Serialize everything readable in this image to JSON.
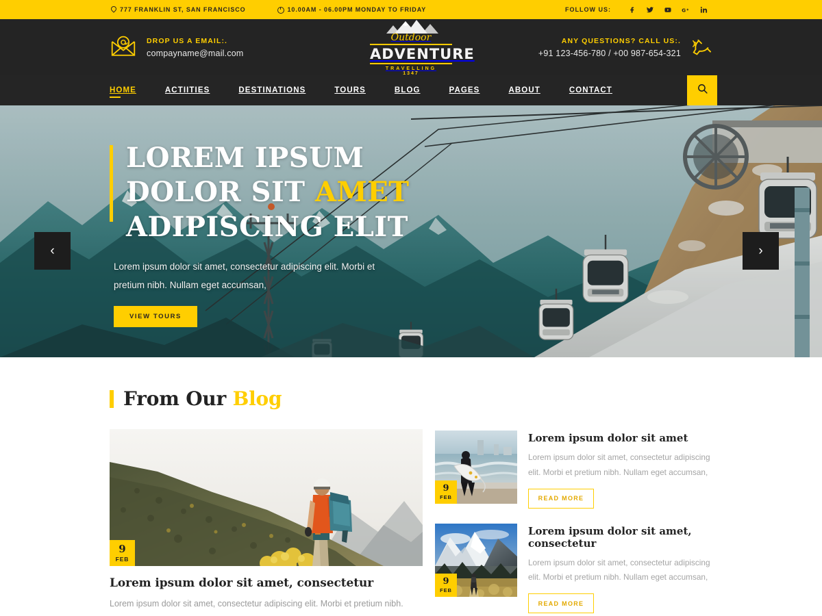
{
  "topbar": {
    "address": "777 FRANKLIN ST, SAN FRANCISCO",
    "hours": "10.00AM - 06.00PM MONDAY TO FRIDAY",
    "follow_label": "FOLLOW US:",
    "socials": [
      {
        "name": "facebook-icon"
      },
      {
        "name": "twitter-icon"
      },
      {
        "name": "youtube-icon"
      },
      {
        "name": "google-plus-icon"
      },
      {
        "name": "linkedin-icon"
      }
    ],
    "bg_color": "#FFCE00",
    "text_color": "#2a2520"
  },
  "header": {
    "email_label": "DROP US A EMAIL:.",
    "email_value": "compayname@mail.com",
    "phone_label": "ANY QUESTIONS? CALL US:.",
    "phone_value": "+91 123-456-780 / +00 987-654-321",
    "logo": {
      "script": "Outdoor",
      "name": "ADVENTURE",
      "tagline": "TRAVELLING",
      "year": "1347"
    },
    "bg_color": "#242424",
    "accent_color": "#FFCE00"
  },
  "nav": {
    "items": [
      {
        "label": "HOME",
        "active": true
      },
      {
        "label": "ACTIITIES",
        "active": false
      },
      {
        "label": "DESTINATIONS",
        "active": false
      },
      {
        "label": "TOURS",
        "active": false
      },
      {
        "label": "BLOG",
        "active": false
      },
      {
        "label": "PAGES",
        "active": false
      },
      {
        "label": "ABOUT",
        "active": false
      },
      {
        "label": "CONTACT",
        "active": false
      }
    ],
    "search_icon": "search-icon"
  },
  "hero": {
    "title_line1": "LOREM IPSUM",
    "title_line2_plain": "DOLOR SIT ",
    "title_line2_accent": "AMET",
    "title_line3": "ADIPISCING ELIT",
    "subtitle": "Lorem ipsum dolor sit amet, consectetur adipiscing elit. Morbi et pretium nibh. Nullam eget accumsan,",
    "button_label": "VIEW TOURS",
    "prev_arrow": "‹",
    "next_arrow": "›",
    "accent_color": "#FFCE00"
  },
  "blog": {
    "heading_plain": "From Our ",
    "heading_accent": "Blog",
    "feature": {
      "date_day": "9",
      "date_month": "FEB",
      "title": "Lorem ipsum dolor sit amet, consectetur",
      "description": "Lorem ipsum dolor sit amet, consectetur adipiscing elit. Morbi et pretium nibh."
    },
    "posts": [
      {
        "date_day": "9",
        "date_month": "FEB",
        "title": "Lorem ipsum dolor sit amet",
        "description": "Lorem ipsum dolor sit amet, consectetur adipiscing elit. Morbi et pretium nibh. Nullam eget accumsan,",
        "button_label": "READ MORE"
      },
      {
        "date_day": "9",
        "date_month": "FEB",
        "title": "Lorem ipsum dolor sit amet, consectetur",
        "description": "Lorem ipsum dolor sit amet, consectetur adipiscing elit. Morbi et pretium nibh. Nullam eget accumsan,",
        "button_label": "READ MORE"
      }
    ]
  }
}
